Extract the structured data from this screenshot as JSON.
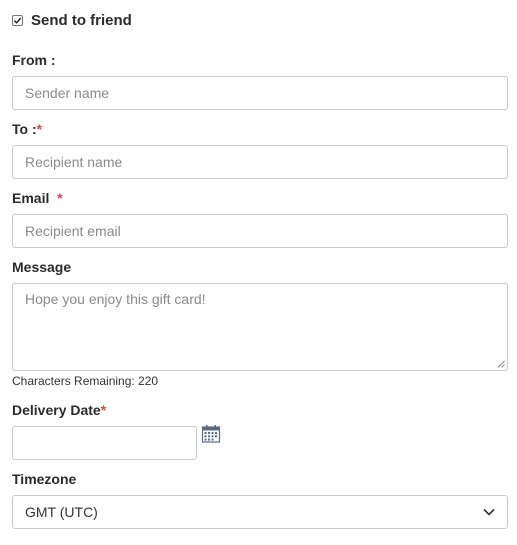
{
  "send_to_friend": {
    "checked": true,
    "label": "Send to friend"
  },
  "from": {
    "label": "From :",
    "placeholder": "Sender name"
  },
  "to": {
    "label": "To :",
    "required_mark": "*",
    "placeholder": "Recipient name"
  },
  "email": {
    "label": "Email",
    "required_mark": "*",
    "placeholder": "Recipient email"
  },
  "message": {
    "label": "Message",
    "placeholder": "Hope you enjoy this gift card!",
    "characters_remaining": "Characters Remaining: 220"
  },
  "delivery_date": {
    "label": "Delivery Date",
    "required_mark": "*",
    "value": "",
    "icon": "calendar-icon"
  },
  "timezone": {
    "label": "Timezone",
    "selected": "GMT (UTC)"
  },
  "colors": {
    "required": "#e4434b",
    "border": "#c9c9c9",
    "placeholder": "#8a8a8a"
  }
}
